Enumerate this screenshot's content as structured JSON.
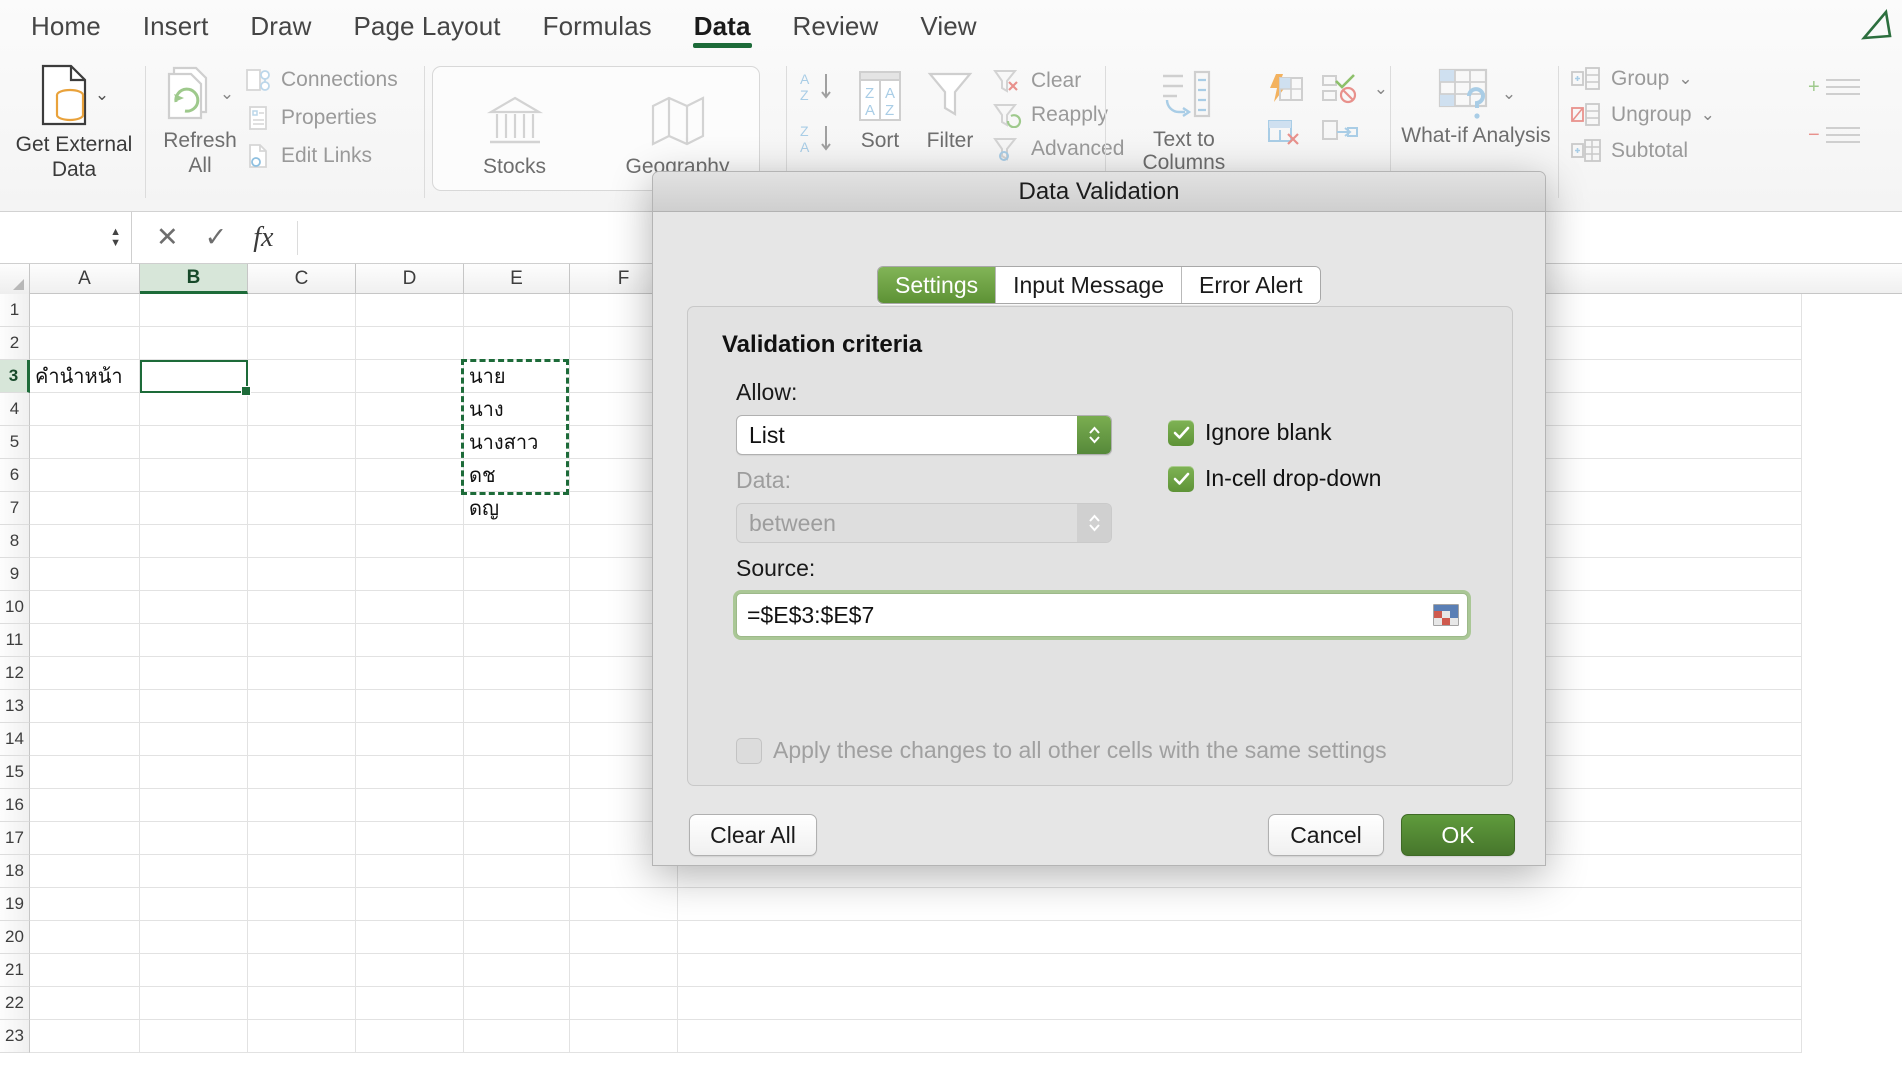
{
  "ribbon": {
    "tabs": [
      {
        "label": "Home",
        "active": false
      },
      {
        "label": "Insert",
        "active": false
      },
      {
        "label": "Draw",
        "active": false
      },
      {
        "label": "Page Layout",
        "active": false
      },
      {
        "label": "Formulas",
        "active": false
      },
      {
        "label": "Data",
        "active": true
      },
      {
        "label": "Review",
        "active": false
      },
      {
        "label": "View",
        "active": false
      }
    ],
    "groups": {
      "get_external_data": "Get External Data",
      "refresh_all": "Refresh All",
      "connections": "Connections",
      "properties": "Properties",
      "edit_links": "Edit Links",
      "stocks": "Stocks",
      "geography": "Geography",
      "sort": "Sort",
      "filter": "Filter",
      "clear": "Clear",
      "reapply": "Reapply",
      "advanced": "Advanced",
      "text_to_columns": "Text to Columns",
      "what_if_analysis": "What-if Analysis",
      "group": "Group",
      "ungroup": "Ungroup",
      "subtotal": "Subtotal"
    }
  },
  "formula_bar": {
    "name_box": "",
    "formula": ""
  },
  "sheet": {
    "columns": [
      "A",
      "B",
      "C",
      "D",
      "E",
      "F"
    ],
    "selected_column": "B",
    "rows": [
      "1",
      "2",
      "3",
      "4",
      "5",
      "6",
      "7",
      "8",
      "9",
      "10",
      "11",
      "12",
      "13",
      "14",
      "15",
      "16",
      "17",
      "18",
      "19",
      "20",
      "21",
      "22",
      "23"
    ],
    "selected_row": "3",
    "cells": {
      "A3": "คำนำหน้า",
      "E3": "นาย",
      "E4": "นาง",
      "E5": "นางสาว",
      "E6": "ดช",
      "E7": "ดญ"
    },
    "active_cell": "B3",
    "copy_range": "E3:E7"
  },
  "dialog": {
    "title": "Data Validation",
    "tabs": [
      {
        "label": "Settings",
        "active": true
      },
      {
        "label": "Input Message",
        "active": false
      },
      {
        "label": "Error Alert",
        "active": false
      }
    ],
    "section_title": "Validation criteria",
    "allow_label": "Allow:",
    "allow_value": "List",
    "data_label": "Data:",
    "data_value": "between",
    "source_label": "Source:",
    "source_value": "=$E$3:$E$7",
    "ignore_blank_label": "Ignore blank",
    "ignore_blank_checked": true,
    "in_cell_dropdown_label": "In-cell drop-down",
    "in_cell_dropdown_checked": true,
    "apply_all_label": "Apply these changes to all other cells with the same settings",
    "apply_all_checked": false,
    "clear_all_label": "Clear All",
    "cancel_label": "Cancel",
    "ok_label": "OK"
  },
  "colors": {
    "accent_green": "#5d9235",
    "tab_underline": "#1d6b39",
    "primary_button": "#47762c"
  }
}
